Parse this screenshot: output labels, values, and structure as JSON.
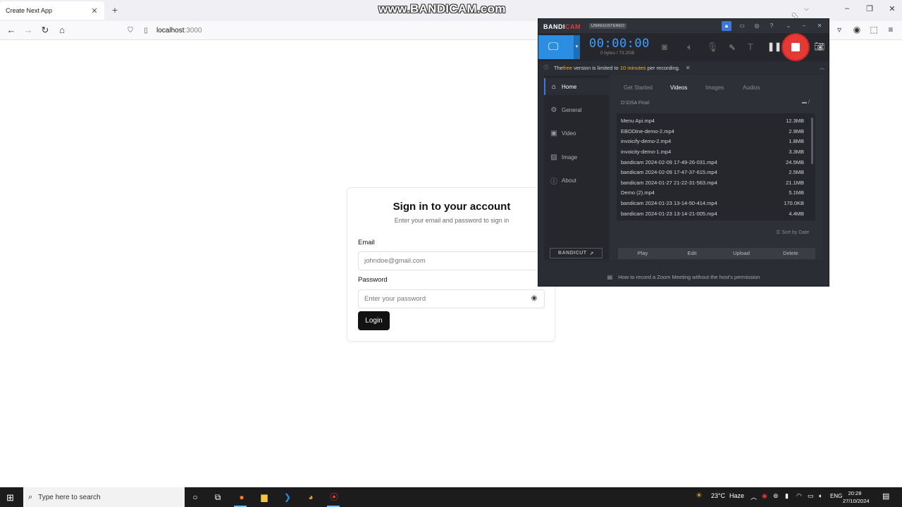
{
  "browser": {
    "tab_title": "Create Next App",
    "tab_close": "✕",
    "new_tab": "+",
    "url_host": "localhost",
    "url_port": ":3000"
  },
  "watermark": "www.BANDICAM.com",
  "login": {
    "title": "Sign in to your account",
    "subtitle": "Enter your email and password to sign in",
    "email_label": "Email",
    "email_placeholder": "johndoe@gmail.com",
    "password_label": "Password",
    "password_placeholder": "Enter your password",
    "login_button": "Login"
  },
  "bandicam": {
    "brand_a": "BANDI",
    "brand_b": "CAM",
    "badge": "UNREGISTERED",
    "timer": "00:00:00",
    "bytes": "0 bytes / 73.2GB",
    "notice": {
      "p1": "The ",
      "free": "free",
      "p2": " version is limited to ",
      "limit": "10 minutes",
      "p3": " per recording."
    },
    "sidebar": [
      "Home",
      "General",
      "Video",
      "Image",
      "About"
    ],
    "bandicut": "BANDICUT",
    "tabs": [
      "Get Started",
      "Videos",
      "Images",
      "Audios"
    ],
    "path": "D:\\DSA Final",
    "files": [
      {
        "name": "Menu Api.mp4",
        "size": "12.3MB"
      },
      {
        "name": "EBODine-demo-2.mp4",
        "size": "2.9MB"
      },
      {
        "name": "invoicify-demo-2.mp4",
        "size": "1.8MB"
      },
      {
        "name": "invoicity-demo-1.mp4",
        "size": "3.3MB"
      },
      {
        "name": "bandicam 2024-02-09 17-49-26-031.mp4",
        "size": "24.5MB"
      },
      {
        "name": "bandicam 2024-02-09 17-47-37-615.mp4",
        "size": "2.5MB"
      },
      {
        "name": "bandicam 2024-01-27 21-22-31-563.mp4",
        "size": "21.1MB"
      },
      {
        "name": "Demo (2).mp4",
        "size": "5.1MB"
      },
      {
        "name": "bandicam 2024-01-23 13-14-50-414.mp4",
        "size": "170.0KB"
      },
      {
        "name": "bandicam 2024-01-23 13-14-21-005.mp4",
        "size": "4.4MB"
      }
    ],
    "sort": "Sort by Date",
    "actions": [
      "Play",
      "Edit",
      "Upload",
      "Delete"
    ],
    "footer": "How to record a Zoom Meeting without the host's permission"
  },
  "taskbar": {
    "search_placeholder": "Type here to search",
    "weather_temp": "23°C",
    "weather_text": "Haze",
    "language": "ENG",
    "time": "20:28",
    "date": "27/10/2024"
  }
}
